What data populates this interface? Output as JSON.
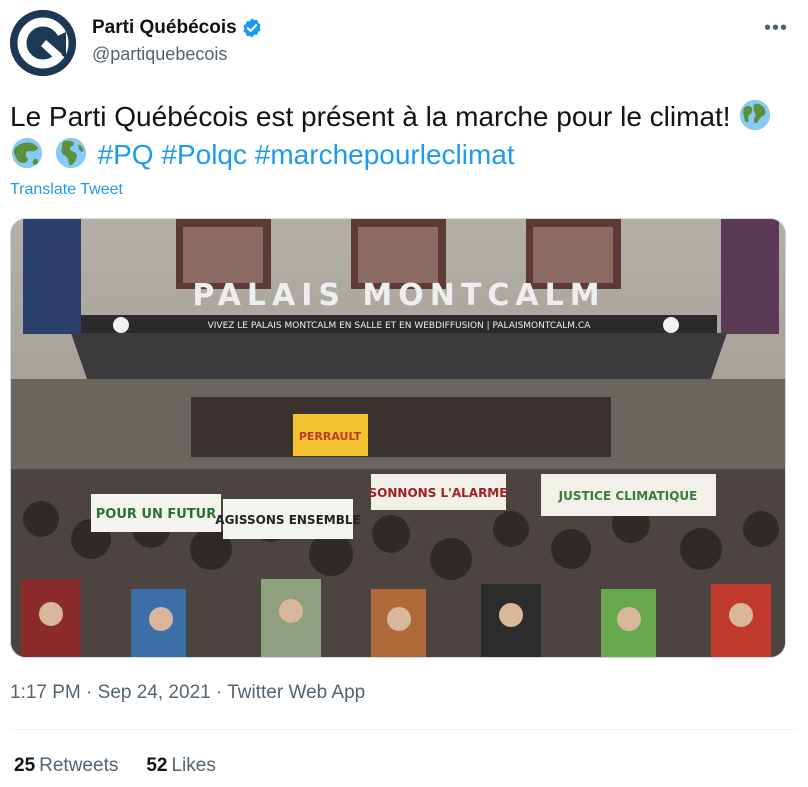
{
  "account": {
    "display_name": "Parti Québécois",
    "handle": "@partiquebecois",
    "verified": true,
    "avatar_icon": "pq-logo-icon",
    "brand_color": "#1d3855"
  },
  "menu": {
    "more_label": "•••"
  },
  "tweet": {
    "text_parts": {
      "sentence": "Le Parti Québécois est présent à la marche pour le climat!",
      "emojis": [
        "earth-globe-americas",
        "earth-globe-asia",
        "earth-globe-europe-africa"
      ],
      "hashtags": [
        "#PQ",
        "#Polqc",
        "#marchepourleclimat"
      ]
    },
    "translate_label": "Translate Tweet",
    "link_color": "#1d9bf0"
  },
  "photo": {
    "building_sign": "PALAIS MONTCALM",
    "banner_line": "VIVEZ LE PALAIS MONTCALM EN SALLE ET EN WEBDIFFUSION | PALAISMONTCALM.CA",
    "protest_signs": [
      "POUR UN FUTUR",
      "AGISSONS ENSEMBLE",
      "SONNONS L'ALARME",
      "JUSTICE CLIMATIQUE",
      "PERRAULT"
    ]
  },
  "meta": {
    "time": "1:17 PM",
    "date": "Sep 24, 2021",
    "source": "Twitter Web App",
    "separator": "·"
  },
  "stats": {
    "retweets_count": "25",
    "retweets_label": "Retweets",
    "likes_count": "52",
    "likes_label": "Likes"
  }
}
